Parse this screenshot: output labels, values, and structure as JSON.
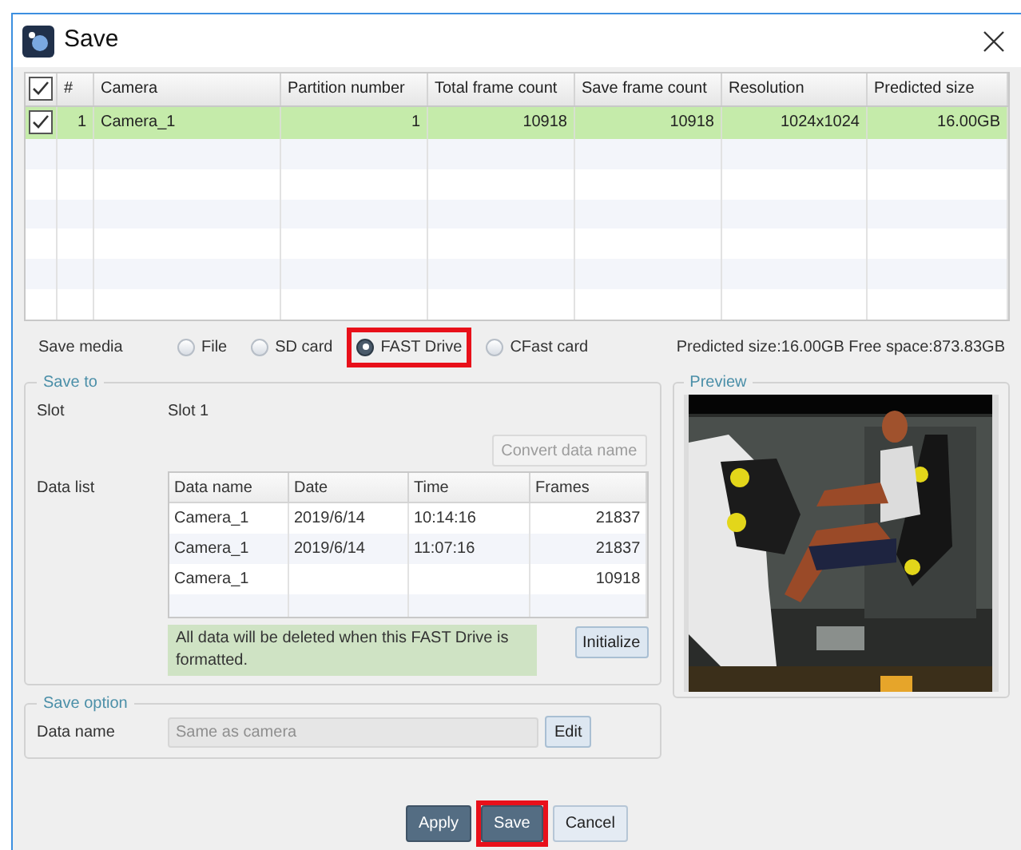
{
  "window": {
    "title": "Save"
  },
  "table": {
    "columns": [
      "#",
      "Camera",
      "Partition number",
      "Total frame count",
      "Save frame count",
      "Resolution",
      "Predicted size"
    ],
    "all_checked": true,
    "rows": [
      {
        "checked": true,
        "selected": true,
        "cells": [
          "1",
          "Camera_1",
          "1",
          "10918",
          "10918",
          "1024x1024",
          "16.00GB"
        ]
      }
    ]
  },
  "save_media": {
    "label": "Save media",
    "options": [
      {
        "label": "File",
        "selected": false,
        "highlighted": false
      },
      {
        "label": "SD card",
        "selected": false,
        "highlighted": false
      },
      {
        "label": "FAST Drive",
        "selected": true,
        "highlighted": true
      },
      {
        "label": "CFast card",
        "selected": false,
        "highlighted": false
      }
    ],
    "info": "Predicted size:16.00GB Free space:873.83GB"
  },
  "save_to": {
    "title": "Save to",
    "slot_label": "Slot",
    "slot_value": "Slot 1",
    "convert_button": {
      "label": "Convert data name",
      "disabled": true
    },
    "data_list_label": "Data list",
    "data_list": {
      "columns": [
        "Data name",
        "Date",
        "Time",
        "Frames"
      ],
      "rows": [
        [
          "Camera_1",
          "2019/6/14",
          "10:14:16",
          "21837"
        ],
        [
          "Camera_1",
          "2019/6/14",
          "11:07:16",
          "21837"
        ],
        [
          "Camera_1",
          "",
          "",
          "10918"
        ]
      ]
    },
    "note": "All data will be deleted when this FAST Drive is formatted.",
    "initialize_button": "Initialize"
  },
  "preview": {
    "title": "Preview",
    "kind": "picture"
  },
  "save_option": {
    "title": "Save option",
    "data_name_label": "Data name",
    "data_name_placeholder": "Same as camera",
    "edit_button": "Edit"
  },
  "buttons": [
    {
      "label": "Apply",
      "highlighted": false
    },
    {
      "label": "Save",
      "highlighted": true
    },
    {
      "label": "Cancel",
      "highlighted": false
    }
  ]
}
